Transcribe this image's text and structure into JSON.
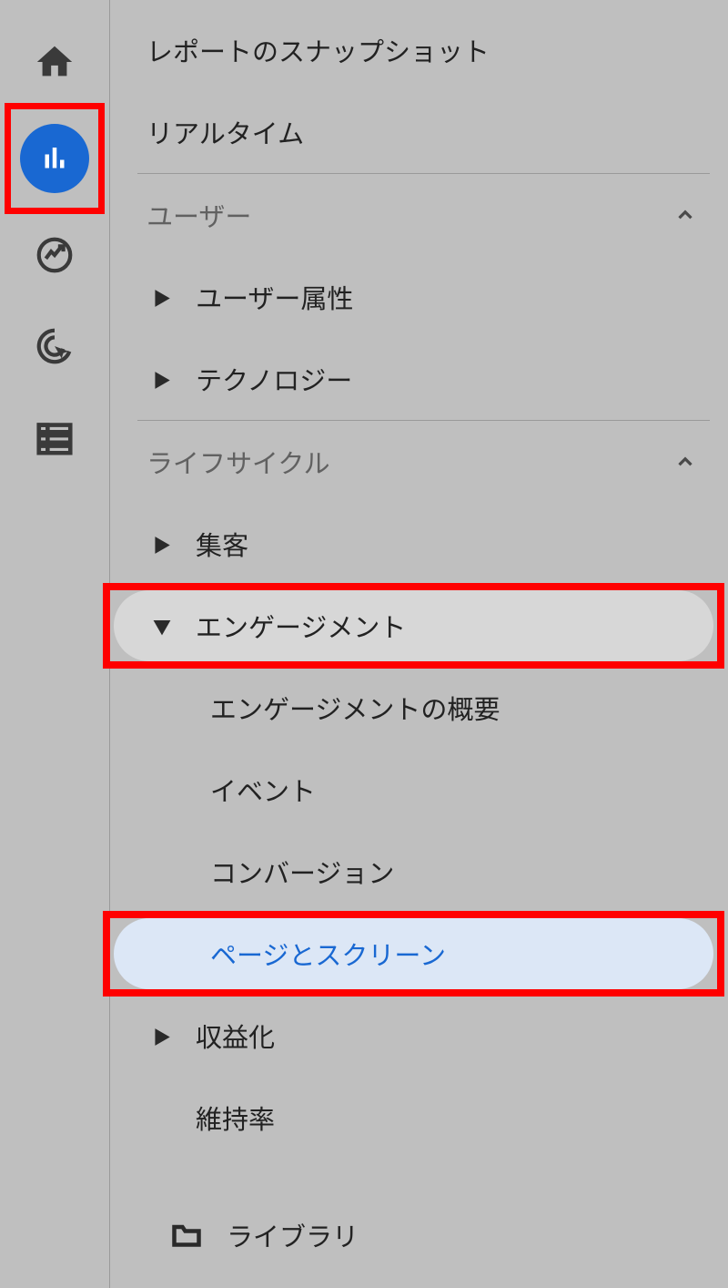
{
  "panel": {
    "snapshot": "レポートのスナップショット",
    "realtime": "リアルタイム",
    "user_section": "ユーザー",
    "user_attributes": "ユーザー属性",
    "technology": "テクノロジー",
    "lifecycle_section": "ライフサイクル",
    "acquisition": "集客",
    "engagement": "エンゲージメント",
    "engagement_overview": "エンゲージメントの概要",
    "events": "イベント",
    "conversions": "コンバージョン",
    "pages_screens": "ページとスクリーン",
    "monetization": "収益化",
    "retention": "維持率",
    "library": "ライブラリ"
  }
}
